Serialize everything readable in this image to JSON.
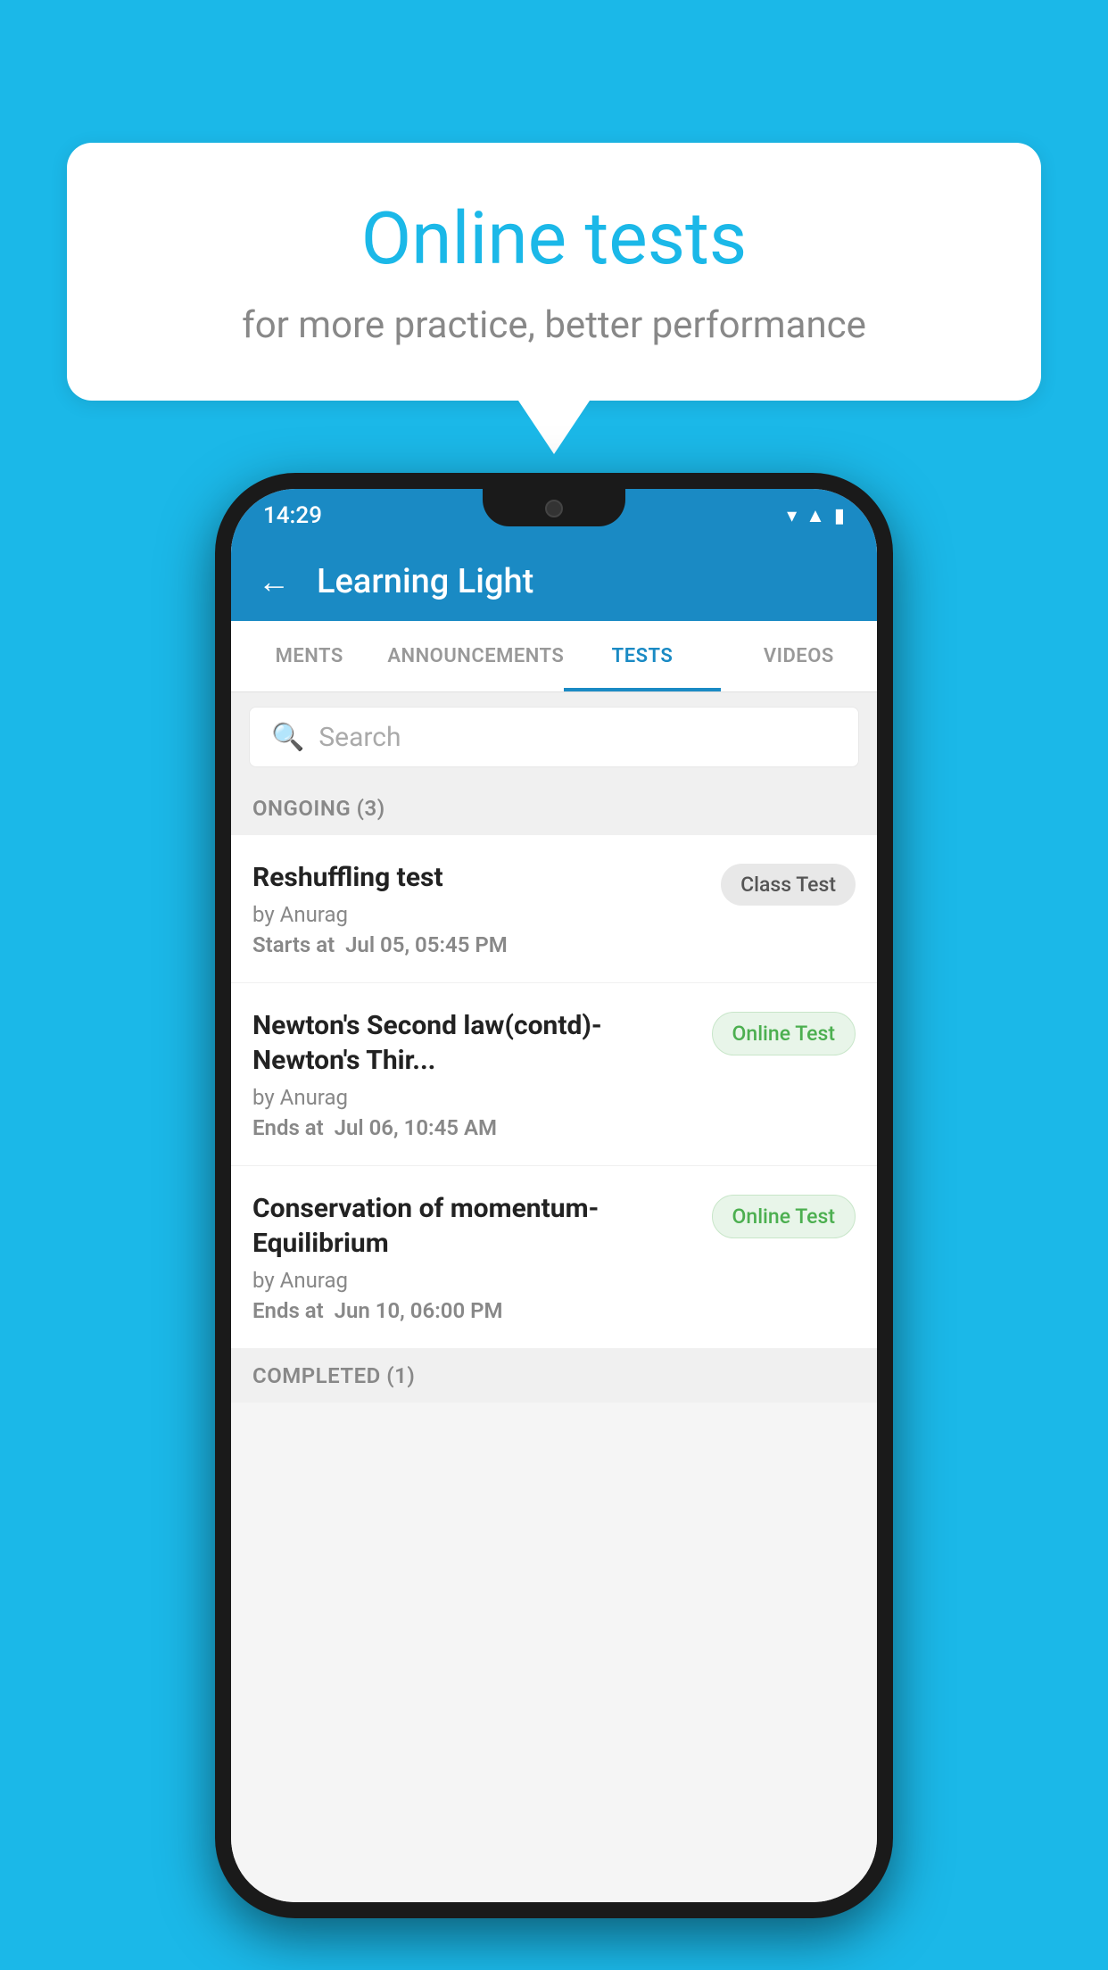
{
  "background": {
    "color": "#1BB8E8"
  },
  "speech_bubble": {
    "title": "Online tests",
    "subtitle": "for more practice, better performance"
  },
  "phone": {
    "status_bar": {
      "time": "14:29",
      "icons": [
        "wifi",
        "signal",
        "battery"
      ]
    },
    "header": {
      "back_label": "←",
      "title": "Learning Light"
    },
    "tabs": [
      {
        "label": "MENTS",
        "active": false
      },
      {
        "label": "ANNOUNCEMENTS",
        "active": false
      },
      {
        "label": "TESTS",
        "active": true
      },
      {
        "label": "VIDEOS",
        "active": false
      }
    ],
    "search": {
      "placeholder": "Search"
    },
    "ongoing_section": {
      "label": "ONGOING (3)",
      "tests": [
        {
          "name": "Reshuffling test",
          "author": "by Anurag",
          "time_label": "Starts at",
          "time_value": "Jul 05, 05:45 PM",
          "badge": "Class Test",
          "badge_type": "class"
        },
        {
          "name": "Newton's Second law(contd)-Newton's Thir...",
          "author": "by Anurag",
          "time_label": "Ends at",
          "time_value": "Jul 06, 10:45 AM",
          "badge": "Online Test",
          "badge_type": "online"
        },
        {
          "name": "Conservation of momentum-Equilibrium",
          "author": "by Anurag",
          "time_label": "Ends at",
          "time_value": "Jun 10, 06:00 PM",
          "badge": "Online Test",
          "badge_type": "online"
        }
      ]
    },
    "completed_section": {
      "label": "COMPLETED (1)"
    }
  }
}
